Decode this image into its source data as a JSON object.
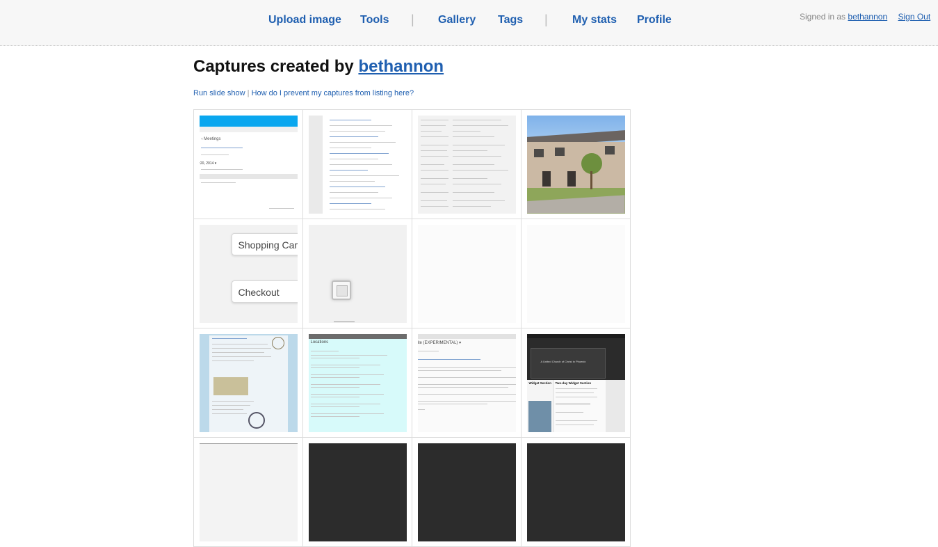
{
  "nav": {
    "upload": "Upload image",
    "tools": "Tools",
    "sep": "|",
    "gallery": "Gallery",
    "tags": "Tags",
    "stats": "My stats",
    "profile": "Profile"
  },
  "account": {
    "signed_in_as": "Signed in as",
    "username": "bethannon",
    "sign_out": "Sign Out"
  },
  "page": {
    "title_prefix": "Captures created by",
    "title_user": "bethannon",
    "slideshow": "Run slide show",
    "link_sep": "|",
    "prevent_listing": "How do I prevent my captures from listing here?"
  },
  "thumbs": {
    "t1": {
      "heading": "‹ Meetings",
      "date": ":20, 2014 ▾"
    },
    "t5": {
      "button1": "Shopping Cart",
      "button2": "Checkout"
    },
    "t10": {
      "heading": "Locations"
    },
    "t11": {
      "heading": "ite (EXPERIMENTAL) ▾"
    },
    "t12": {
      "card": "A United Church of Christ in Phoenix",
      "widget": "Widget Section",
      "heading": "Two-day Widget Section"
    }
  },
  "colors": {
    "link": "#1f5fb0",
    "accent_blue": "#0aa7ef"
  }
}
